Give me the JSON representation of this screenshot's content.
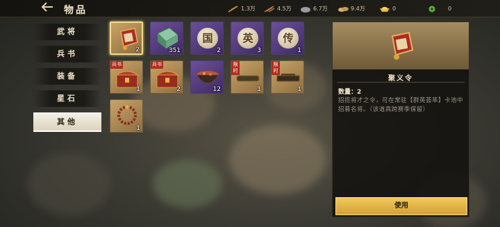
{
  "header": {
    "title": "物品",
    "resources": [
      {
        "name": "wood",
        "value": "1.3万",
        "icon": "feather-icon",
        "color": "#c98a4a"
      },
      {
        "name": "grain",
        "value": "4.5万",
        "icon": "wheat-icon",
        "color": "#c57a4e"
      },
      {
        "name": "stone",
        "value": "6.7万",
        "icon": "stone-icon",
        "color": "#9b9b9b"
      },
      {
        "name": "coin",
        "value": "9.4万",
        "icon": "coins-icon",
        "color": "#d9b36a"
      },
      {
        "name": "gold",
        "value": "0",
        "icon": "gold-ingot-icon",
        "color": "#e8b63a"
      },
      {
        "name": "jade",
        "value": "0",
        "icon": "jade-icon",
        "color": "#5fae45"
      }
    ]
  },
  "sidebar": {
    "tabs": [
      {
        "label": "武将",
        "active": false
      },
      {
        "label": "兵书",
        "active": false
      },
      {
        "label": "装备",
        "active": false
      },
      {
        "label": "星石",
        "active": false
      },
      {
        "label": "其他",
        "active": true
      }
    ]
  },
  "items": [
    {
      "icon": "scroll-token-icon",
      "count": "2",
      "style": "gold",
      "selected": true,
      "tag": ""
    },
    {
      "icon": "green-book-icon",
      "count": "351",
      "style": "purple",
      "selected": false,
      "tag": ""
    },
    {
      "icon": "coin-guo-icon",
      "glyph": "国",
      "count": "2",
      "style": "purple",
      "selected": false,
      "tag": ""
    },
    {
      "icon": "coin-ying-icon",
      "glyph": "英",
      "count": "3",
      "style": "purple",
      "selected": false,
      "tag": ""
    },
    {
      "icon": "coin-chuan-icon",
      "glyph": "传",
      "count": "1",
      "style": "purple",
      "selected": false,
      "tag": ""
    },
    {
      "icon": "treasure-chest-icon",
      "count": "1",
      "style": "gold",
      "selected": false,
      "tag": "兵书"
    },
    {
      "icon": "treasure-chest-icon",
      "count": "2",
      "style": "gold",
      "selected": false,
      "tag": "兵书"
    },
    {
      "icon": "food-bowl-icon",
      "count": "12",
      "style": "purple",
      "selected": false,
      "tag": ""
    },
    {
      "icon": "mat-icon",
      "count": "1",
      "style": "gold",
      "selected": false,
      "tag": "限时"
    },
    {
      "icon": "tray-icon",
      "count": "1",
      "style": "gold",
      "selected": false,
      "tag": "限时"
    },
    {
      "icon": "bead-bracelet-icon",
      "count": "1",
      "style": "gold",
      "selected": false,
      "tag": ""
    }
  ],
  "detail": {
    "name": "聚义令",
    "quantity_label": "数量：2",
    "description": "招揽将才之令，可在常驻【群英荟萃】卡池中招募名将。（该道具跨赛季保留）",
    "use_label": "使用"
  }
}
